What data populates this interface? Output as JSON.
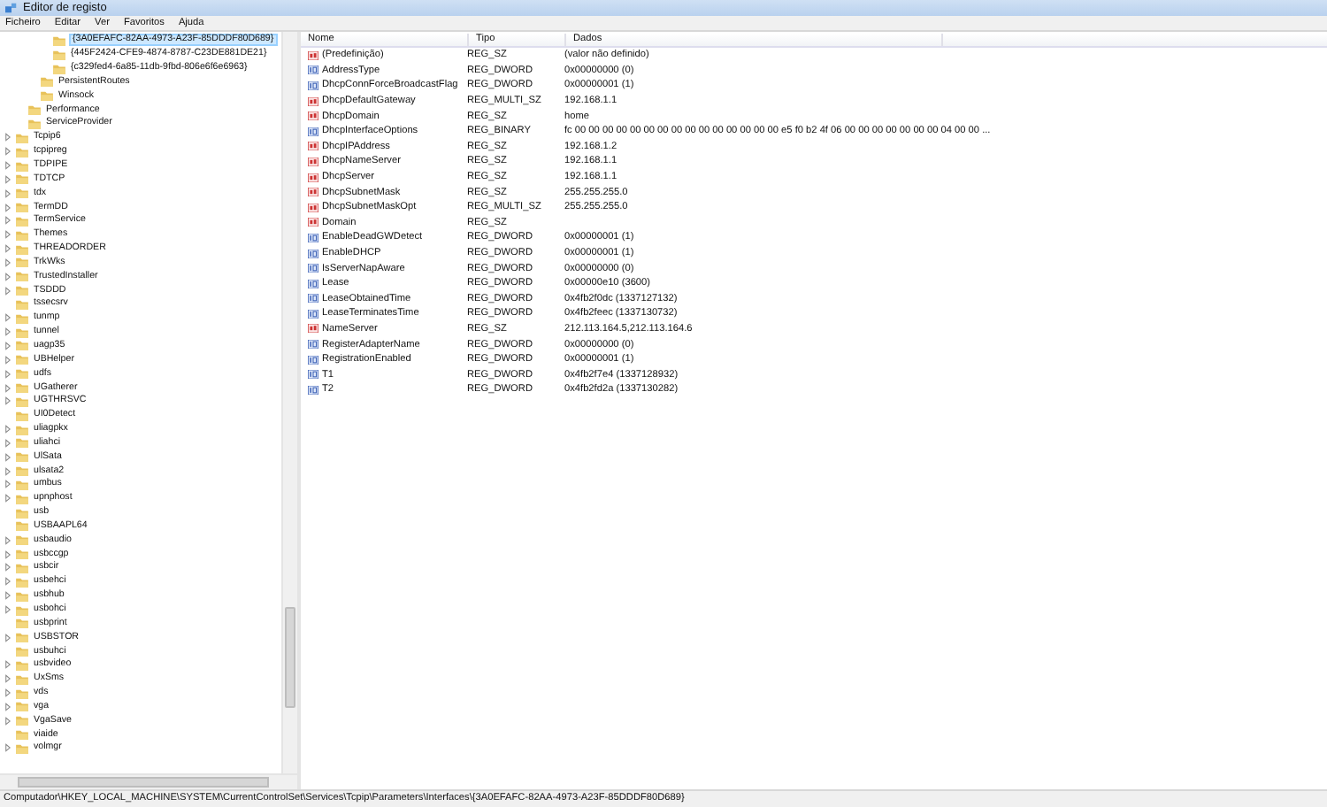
{
  "window": {
    "title": "Editor de registo"
  },
  "menu": [
    "Ficheiro",
    "Editar",
    "Ver",
    "Favoritos",
    "Ajuda"
  ],
  "tree": [
    {
      "children": [
        {
          "children": [
            {
              "children": [
                {
                  "label": "{3A0EFAFC-82AA-4973-A23F-85DDDF80D689}",
                  "expandable": false,
                  "selected": true
                },
                {
                  "label": "{445F2424-CFE9-4874-8787-C23DE881DE21}",
                  "expandable": false,
                  "selected": false
                },
                {
                  "label": "{c329fed4-6a85-11db-9fbd-806e6f6e6963}",
                  "expandable": false,
                  "selected": false
                }
              ]
            },
            {
              "label": "PersistentRoutes",
              "expandable": false,
              "selected": false
            },
            {
              "label": "Winsock",
              "expandable": false,
              "selected": false
            }
          ]
        },
        {
          "label": "Performance",
          "expandable": false,
          "selected": false
        },
        {
          "label": "ServiceProvider",
          "expandable": false,
          "selected": false
        }
      ]
    },
    {
      "label": "Tcpip6",
      "expandable": true,
      "selected": false
    },
    {
      "label": "tcpipreg",
      "expandable": true,
      "selected": false
    },
    {
      "label": "TDPIPE",
      "expandable": true,
      "selected": false
    },
    {
      "label": "TDTCP",
      "expandable": true,
      "selected": false
    },
    {
      "label": "tdx",
      "expandable": true,
      "selected": false
    },
    {
      "label": "TermDD",
      "expandable": true,
      "selected": false
    },
    {
      "label": "TermService",
      "expandable": true,
      "selected": false
    },
    {
      "label": "Themes",
      "expandable": true,
      "selected": false
    },
    {
      "label": "THREADORDER",
      "expandable": true,
      "selected": false
    },
    {
      "label": "TrkWks",
      "expandable": true,
      "selected": false
    },
    {
      "label": "TrustedInstaller",
      "expandable": true,
      "selected": false
    },
    {
      "label": "TSDDD",
      "expandable": true,
      "selected": false
    },
    {
      "label": "tssecsrv",
      "expandable": false,
      "selected": false
    },
    {
      "label": "tunmp",
      "expandable": true,
      "selected": false
    },
    {
      "label": "tunnel",
      "expandable": true,
      "selected": false
    },
    {
      "label": "uagp35",
      "expandable": true,
      "selected": false
    },
    {
      "label": "UBHelper",
      "expandable": true,
      "selected": false
    },
    {
      "label": "udfs",
      "expandable": true,
      "selected": false
    },
    {
      "label": "UGatherer",
      "expandable": true,
      "selected": false
    },
    {
      "label": "UGTHRSVC",
      "expandable": true,
      "selected": false
    },
    {
      "label": "UI0Detect",
      "expandable": false,
      "selected": false
    },
    {
      "label": "uliagpkx",
      "expandable": true,
      "selected": false
    },
    {
      "label": "uliahci",
      "expandable": true,
      "selected": false
    },
    {
      "label": "UlSata",
      "expandable": true,
      "selected": false
    },
    {
      "label": "ulsata2",
      "expandable": true,
      "selected": false
    },
    {
      "label": "umbus",
      "expandable": true,
      "selected": false
    },
    {
      "label": "upnphost",
      "expandable": true,
      "selected": false
    },
    {
      "label": "usb",
      "expandable": false,
      "selected": false
    },
    {
      "label": "USBAAPL64",
      "expandable": false,
      "selected": false
    },
    {
      "label": "usbaudio",
      "expandable": true,
      "selected": false
    },
    {
      "label": "usbccgp",
      "expandable": true,
      "selected": false
    },
    {
      "label": "usbcir",
      "expandable": true,
      "selected": false
    },
    {
      "label": "usbehci",
      "expandable": true,
      "selected": false
    },
    {
      "label": "usbhub",
      "expandable": true,
      "selected": false
    },
    {
      "label": "usbohci",
      "expandable": true,
      "selected": false
    },
    {
      "label": "usbprint",
      "expandable": false,
      "selected": false
    },
    {
      "label": "USBSTOR",
      "expandable": true,
      "selected": false
    },
    {
      "label": "usbuhci",
      "expandable": false,
      "selected": false
    },
    {
      "label": "usbvideo",
      "expandable": true,
      "selected": false
    },
    {
      "label": "UxSms",
      "expandable": true,
      "selected": false
    },
    {
      "label": "vds",
      "expandable": true,
      "selected": false
    },
    {
      "label": "vga",
      "expandable": true,
      "selected": false
    },
    {
      "label": "VgaSave",
      "expandable": true,
      "selected": false
    },
    {
      "label": "viaide",
      "expandable": false,
      "selected": false
    },
    {
      "label": "volmgr",
      "expandable": true,
      "selected": false
    }
  ],
  "table": {
    "columns": [
      "Nome",
      "Tipo",
      "Dados"
    ],
    "rows": [
      {
        "kind": "string",
        "name": "(Predefinição)",
        "type": "REG_SZ",
        "data": "(valor não definido)"
      },
      {
        "kind": "binary",
        "name": "AddressType",
        "type": "REG_DWORD",
        "data": "0x00000000 (0)"
      },
      {
        "kind": "binary",
        "name": "DhcpConnForceBroadcastFlag",
        "type": "REG_DWORD",
        "data": "0x00000001 (1)"
      },
      {
        "kind": "string",
        "name": "DhcpDefaultGateway",
        "type": "REG_MULTI_SZ",
        "data": "192.168.1.1"
      },
      {
        "kind": "string",
        "name": "DhcpDomain",
        "type": "REG_SZ",
        "data": "home"
      },
      {
        "kind": "binary",
        "name": "DhcpInterfaceOptions",
        "type": "REG_BINARY",
        "data": "fc 00 00 00 00 00 00 00 00 00 00 00 00 00 00 00 e5 f0 b2 4f 06 00 00 00 00 00 00 00 04 00 00 ..."
      },
      {
        "kind": "string",
        "name": "DhcpIPAddress",
        "type": "REG_SZ",
        "data": "192.168.1.2"
      },
      {
        "kind": "string",
        "name": "DhcpNameServer",
        "type": "REG_SZ",
        "data": "192.168.1.1"
      },
      {
        "kind": "string",
        "name": "DhcpServer",
        "type": "REG_SZ",
        "data": "192.168.1.1"
      },
      {
        "kind": "string",
        "name": "DhcpSubnetMask",
        "type": "REG_SZ",
        "data": "255.255.255.0"
      },
      {
        "kind": "string",
        "name": "DhcpSubnetMaskOpt",
        "type": "REG_MULTI_SZ",
        "data": "255.255.255.0"
      },
      {
        "kind": "string",
        "name": "Domain",
        "type": "REG_SZ"
      },
      {
        "kind": "binary",
        "name": "EnableDeadGWDetect",
        "type": "REG_DWORD",
        "data": "0x00000001 (1)"
      },
      {
        "kind": "binary",
        "name": "EnableDHCP",
        "type": "REG_DWORD",
        "data": "0x00000001 (1)"
      },
      {
        "kind": "binary",
        "name": "IsServerNapAware",
        "type": "REG_DWORD",
        "data": "0x00000000 (0)"
      },
      {
        "kind": "binary",
        "name": "Lease",
        "type": "REG_DWORD",
        "data": "0x00000e10 (3600)"
      },
      {
        "kind": "binary",
        "name": "LeaseObtainedTime",
        "type": "REG_DWORD",
        "data": "0x4fb2f0dc (1337127132)"
      },
      {
        "kind": "binary",
        "name": "LeaseTerminatesTime",
        "type": "REG_DWORD",
        "data": "0x4fb2feec (1337130732)"
      },
      {
        "kind": "string",
        "name": "NameServer",
        "type": "REG_SZ",
        "data": "212.113.164.5,212.113.164.6"
      },
      {
        "kind": "binary",
        "name": "RegisterAdapterName",
        "type": "REG_DWORD",
        "data": "0x00000000 (0)"
      },
      {
        "kind": "binary",
        "name": "RegistrationEnabled",
        "type": "REG_DWORD",
        "data": "0x00000001 (1)"
      },
      {
        "kind": "binary",
        "name": "T1",
        "type": "REG_DWORD",
        "data": "0x4fb2f7e4 (1337128932)"
      },
      {
        "kind": "binary",
        "name": "T2",
        "type": "REG_DWORD",
        "data": "0x4fb2fd2a (1337130282)"
      }
    ]
  },
  "status_bar": "Computador\\HKEY_LOCAL_MACHINE\\SYSTEM\\CurrentControlSet\\Services\\Tcpip\\Parameters\\Interfaces\\{3A0EFAFC-82AA-4973-A23F-85DDDF80D689}"
}
